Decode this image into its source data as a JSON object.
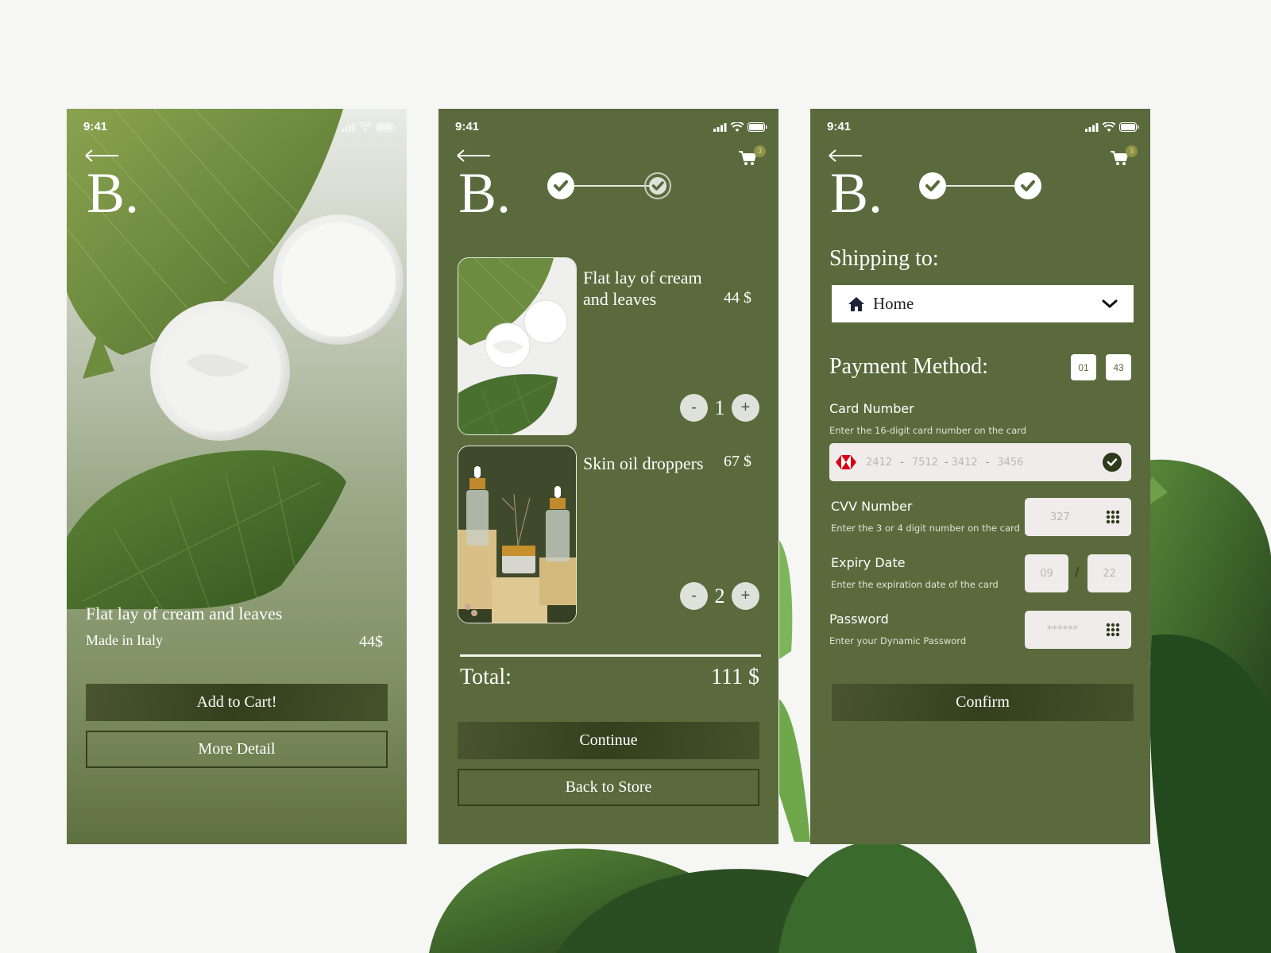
{
  "status_bar": {
    "time": "9:41"
  },
  "brand": {
    "logo": "B."
  },
  "colors": {
    "primary": "#5a6a3c",
    "button_dark": "#34401d",
    "badge": "#8f9145",
    "input_bg": "#efeceb"
  },
  "screen_product": {
    "title": "Flat lay of cream and leaves",
    "origin": "Made in Italy",
    "price": "44$",
    "add_to_cart_label": "Add to Cart!",
    "more_detail_label": "More Detail"
  },
  "screen_cart": {
    "cart_count": "3",
    "steps": [
      {
        "state": "completed"
      },
      {
        "state": "completed-outline"
      }
    ],
    "items": [
      {
        "name": "Flat lay of cream and leaves",
        "price": "44 $",
        "quantity": "1",
        "image": "cream-and-leaves"
      },
      {
        "name": "Skin oil droppers",
        "price": "67 $",
        "quantity": "2",
        "image": "oil-droppers"
      }
    ],
    "minus_symbol": "-",
    "plus_symbol": "+",
    "total_label": "Total:",
    "total_value": "111 $",
    "continue_label": "Continue",
    "back_to_store_label": "Back to Store"
  },
  "screen_payment": {
    "cart_count": "3",
    "steps": [
      {
        "state": "completed"
      },
      {
        "state": "completed"
      }
    ],
    "shipping_heading": "Shipping to:",
    "shipping_selected": "Home",
    "payment_heading": "Payment Method:",
    "payment_codes": [
      "01",
      "43"
    ],
    "card_number": {
      "label": "Card Number",
      "help": "Enter the 16-digit card number on the card",
      "groups": [
        "2412",
        "7512",
        "3412",
        "3456"
      ],
      "separator": "-"
    },
    "cvv": {
      "label": "CVV Number",
      "help": "Enter the 3 or 4 digit number on the card",
      "placeholder": "327"
    },
    "expiry": {
      "label": "Expiry Date",
      "help": "Enter the expiration date of the card",
      "month": "09",
      "year": "22",
      "separator": "/"
    },
    "password": {
      "label": "Password",
      "help": "Enter your Dynamic Password",
      "placeholder": "******"
    },
    "confirm_label": "Confirm"
  }
}
